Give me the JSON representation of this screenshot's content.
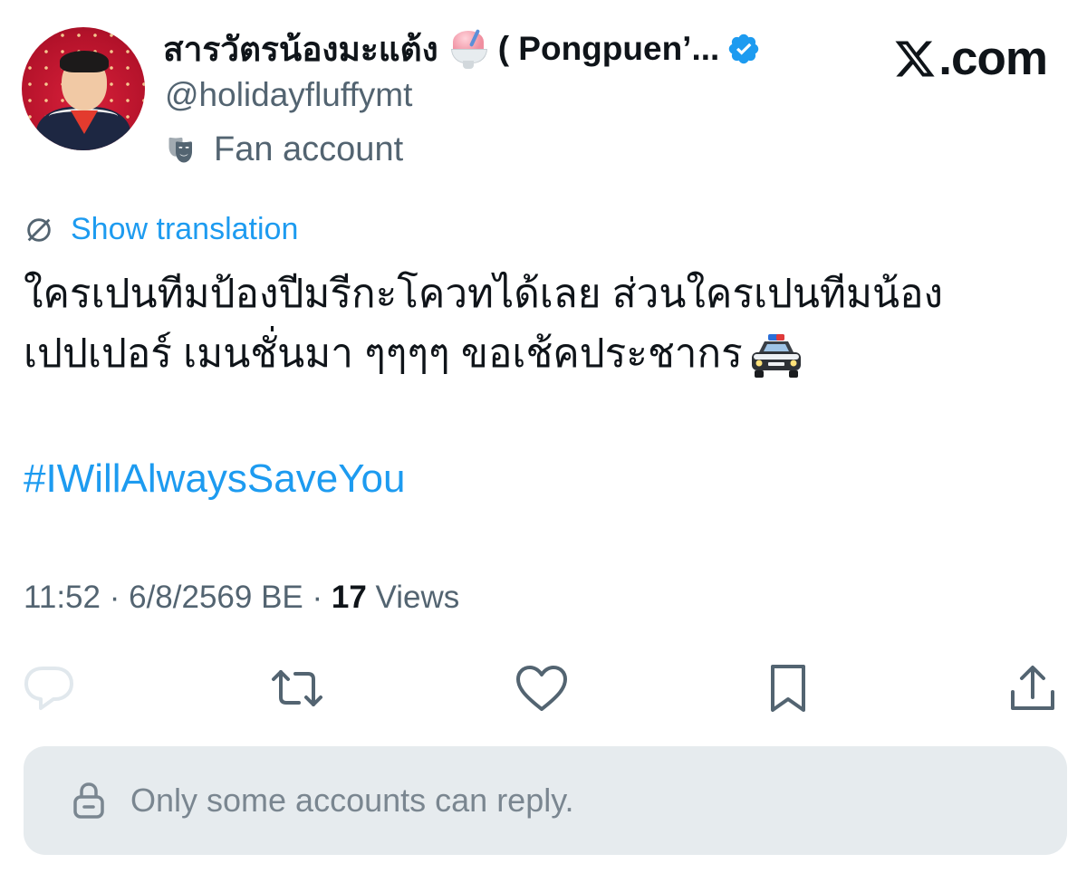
{
  "author": {
    "display_name": "สารวัตรน้องมะแต้ง",
    "name_suffix": "( Pongpuen’...",
    "handle": "@holidayfluffymt",
    "affiliation": "Fan account",
    "emoji_icon": "shaved-ice-emoji",
    "badge_icon": "verified-badge-icon"
  },
  "brand": {
    "site": ".com",
    "logo_icon": "x-logo-icon"
  },
  "translation": {
    "label": "Show translation",
    "icon": "globe-icon"
  },
  "tweet": {
    "line1": "ใครเปนทีมป้องปีมรีกะโควทได้เลย ส่วนใครเปนทีมน้อง",
    "line2": "เปปเปอร์ เมนชั่นมา ๆๆๆๆ ขอเช้คประชากร",
    "line2_emoji": "police-car-emoji",
    "hashtag": "#IWillAlwaysSaveYou"
  },
  "meta": {
    "time": "11:52",
    "separator": " · ",
    "date": "6/8/2569 BE",
    "views_count": "17",
    "views_label": "Views"
  },
  "actions": {
    "reply_icon": "reply-icon",
    "retweet_icon": "retweet-icon",
    "like_icon": "heart-icon",
    "bookmark_icon": "bookmark-icon",
    "share_icon": "share-icon"
  },
  "reply_restriction": {
    "text": "Only some accounts can reply.",
    "icon": "lock-icon"
  },
  "colors": {
    "accent": "#1d9bf0",
    "text_primary": "#0f1419",
    "text_secondary": "#536471",
    "reply_box_bg": "#e6ebee"
  }
}
